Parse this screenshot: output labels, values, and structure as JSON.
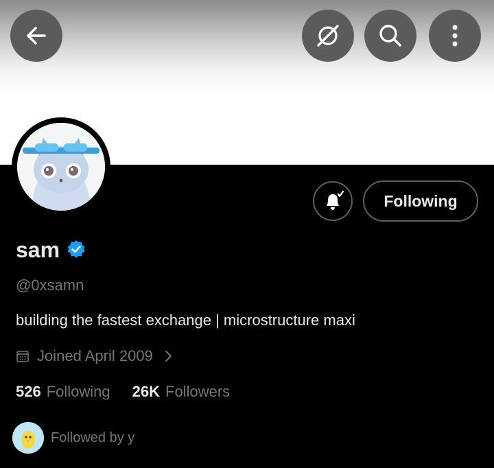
{
  "header": {
    "back_icon": "arrow-left-icon",
    "grok_icon": "grok-icon",
    "search_icon": "search-icon",
    "more_icon": "more-vertical-icon"
  },
  "profile": {
    "name": "sam",
    "verified": true,
    "handle": "@0xsamn",
    "bio": "building the fastest exchange | microstructure maxi",
    "joined": "Joined April 2009",
    "following_count": "526",
    "following_label": "Following",
    "followers_count": "26K",
    "followers_label": "Followers",
    "followed_by": "Followed by y"
  },
  "actions": {
    "notify_icon": "bell-check-icon",
    "follow_state_label": "Following"
  },
  "colors": {
    "background": "#000000",
    "primary_text": "#e7e9ea",
    "secondary_text": "#71767b",
    "verified_blue": "#1d9bf0",
    "button_border": "#5c6063",
    "header_button_bg": "#5b5b5b"
  }
}
